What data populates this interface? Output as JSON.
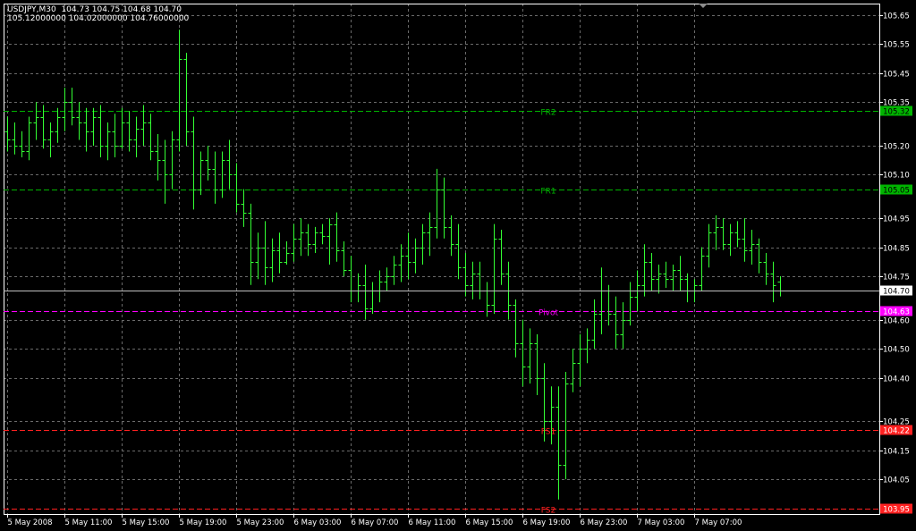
{
  "header": {
    "symbol_timeframe": "USDJPY,M30",
    "ohlc": "104.73 104.75 104.68 104.70",
    "indicator_values": "105.12000000 104.02000000 104.76000000"
  },
  "colors": {
    "background": "#000000",
    "grid": "#6a6a6a",
    "frame": "#ffffff",
    "bars": "#33ff33",
    "resistance": "#00b400",
    "pivot": "#ff00ff",
    "support": "#ff2020",
    "bid_line": "#c0c0c0",
    "axis_text": "#ffffff"
  },
  "chart_data": {
    "type": "ohlc",
    "title": "USDJPY,M30",
    "y_ticks": [
      "105.65",
      "105.55",
      "105.45",
      "105.35",
      "105.20",
      "105.10",
      "104.95",
      "104.85",
      "104.75",
      "104.60",
      "104.50",
      "104.40",
      "104.25",
      "104.15",
      "104.05"
    ],
    "y_tick_values": [
      105.65,
      105.55,
      105.45,
      105.35,
      105.2,
      105.1,
      104.95,
      104.85,
      104.75,
      104.6,
      104.5,
      104.4,
      104.25,
      104.15,
      104.05
    ],
    "ylim": [
      103.93,
      105.69
    ],
    "x_ticks": [
      "5 May 2008",
      "5 May 11:00",
      "5 May 15:00",
      "5 May 19:00",
      "5 May 23:00",
      "6 May 03:00",
      "6 May 07:00",
      "6 May 11:00",
      "6 May 15:00",
      "6 May 19:00",
      "6 May 23:00",
      "7 May 03:00",
      "7 May 07:00"
    ],
    "x_tick_bar_index": [
      0,
      8,
      16,
      24,
      32,
      40,
      48,
      56,
      64,
      72,
      80,
      88,
      96
    ],
    "bars_visible_slots": 121,
    "grid": true,
    "levels": [
      {
        "label": "FR2",
        "value": 105.32,
        "tag": "105.32",
        "kind": "resistance"
      },
      {
        "label": "FR1",
        "value": 105.05,
        "tag": "105.05",
        "kind": "resistance"
      },
      {
        "label": "Pivot",
        "value": 104.63,
        "tag": "104.63",
        "kind": "pivot"
      },
      {
        "label": "FS1",
        "value": 104.22,
        "tag": "104.22",
        "kind": "support"
      },
      {
        "label": "FS2",
        "value": 103.95,
        "tag": "103.95",
        "kind": "support"
      }
    ],
    "current_price": {
      "value": 104.7,
      "tag": "104.70"
    },
    "ohlc": [
      [
        105.25,
        105.3,
        105.18,
        105.22
      ],
      [
        105.22,
        105.28,
        105.17,
        105.2
      ],
      [
        105.2,
        105.25,
        105.16,
        105.18
      ],
      [
        105.18,
        105.3,
        105.15,
        105.28
      ],
      [
        105.28,
        105.35,
        105.22,
        105.3
      ],
      [
        105.3,
        105.34,
        105.19,
        105.22
      ],
      [
        105.22,
        105.28,
        105.16,
        105.25
      ],
      [
        105.25,
        105.33,
        105.21,
        105.3
      ],
      [
        105.3,
        105.4,
        105.25,
        105.35
      ],
      [
        105.35,
        105.4,
        105.27,
        105.3
      ],
      [
        105.3,
        105.35,
        105.22,
        105.28
      ],
      [
        105.28,
        105.33,
        105.18,
        105.25
      ],
      [
        105.25,
        105.33,
        105.2,
        105.3
      ],
      [
        105.3,
        105.34,
        105.16,
        105.2
      ],
      [
        105.2,
        105.28,
        105.15,
        105.25
      ],
      [
        105.25,
        105.31,
        105.16,
        105.2
      ],
      [
        105.2,
        105.33,
        105.19,
        105.28
      ],
      [
        105.28,
        105.32,
        105.18,
        105.22
      ],
      [
        105.22,
        105.3,
        105.16,
        105.26
      ],
      [
        105.26,
        105.34,
        105.2,
        105.28
      ],
      [
        105.28,
        105.31,
        105.15,
        105.18
      ],
      [
        105.18,
        105.24,
        105.08,
        105.15
      ],
      [
        105.15,
        105.22,
        105.0,
        105.1
      ],
      [
        105.1,
        105.25,
        105.05,
        105.22
      ],
      [
        105.22,
        105.6,
        105.18,
        105.5
      ],
      [
        105.5,
        105.52,
        105.2,
        105.25
      ],
      [
        105.25,
        105.3,
        104.98,
        105.05
      ],
      [
        105.05,
        105.18,
        105.03,
        105.15
      ],
      [
        105.15,
        105.2,
        105.08,
        105.12
      ],
      [
        105.12,
        105.18,
        105.0,
        105.05
      ],
      [
        105.05,
        105.18,
        105.02,
        105.15
      ],
      [
        105.15,
        105.22,
        105.05,
        105.1
      ],
      [
        105.1,
        105.14,
        104.97,
        105.0
      ],
      [
        105.0,
        105.05,
        104.92,
        104.97
      ],
      [
        104.97,
        105.0,
        104.72,
        104.8
      ],
      [
        104.8,
        104.9,
        104.74,
        104.85
      ],
      [
        104.85,
        104.94,
        104.72,
        104.78
      ],
      [
        104.78,
        104.88,
        104.73,
        104.84
      ],
      [
        104.84,
        104.9,
        104.76,
        104.8
      ],
      [
        104.8,
        104.87,
        104.79,
        104.83
      ],
      [
        104.83,
        104.93,
        104.8,
        104.88
      ],
      [
        104.88,
        104.95,
        104.82,
        104.9
      ],
      [
        104.9,
        104.93,
        104.82,
        104.86
      ],
      [
        104.86,
        104.92,
        104.83,
        104.9
      ],
      [
        104.9,
        104.93,
        104.86,
        104.89
      ],
      [
        104.89,
        104.95,
        104.79,
        104.93
      ],
      [
        104.93,
        104.97,
        104.8,
        104.84
      ],
      [
        104.84,
        104.87,
        104.75,
        104.77
      ],
      [
        104.77,
        104.82,
        104.66,
        104.7
      ],
      [
        104.7,
        104.76,
        104.66,
        104.72
      ],
      [
        104.72,
        104.79,
        104.6,
        104.64
      ],
      [
        104.64,
        104.73,
        104.62,
        104.7
      ],
      [
        104.7,
        104.77,
        104.66,
        104.73
      ],
      [
        104.73,
        104.78,
        104.7,
        104.75
      ],
      [
        104.75,
        104.82,
        104.72,
        104.79
      ],
      [
        104.79,
        104.86,
        104.73,
        104.82
      ],
      [
        104.82,
        104.9,
        104.74,
        104.8
      ],
      [
        104.8,
        104.88,
        104.76,
        104.85
      ],
      [
        104.85,
        104.93,
        104.79,
        104.9
      ],
      [
        104.9,
        104.97,
        104.82,
        104.92
      ],
      [
        104.92,
        105.12,
        104.88,
        105.05
      ],
      [
        105.05,
        105.09,
        104.88,
        104.92
      ],
      [
        104.92,
        104.96,
        104.82,
        104.86
      ],
      [
        104.86,
        104.93,
        104.74,
        104.78
      ],
      [
        104.78,
        104.83,
        104.68,
        104.72
      ],
      [
        104.72,
        104.8,
        104.67,
        104.76
      ],
      [
        104.76,
        104.8,
        104.67,
        104.7
      ],
      [
        104.7,
        104.73,
        104.61,
        104.65
      ],
      [
        104.65,
        104.93,
        104.62,
        104.88
      ],
      [
        104.88,
        104.91,
        104.72,
        104.76
      ],
      [
        104.76,
        104.8,
        104.6,
        104.65
      ],
      [
        104.65,
        104.67,
        104.47,
        104.52
      ],
      [
        104.52,
        104.6,
        104.37,
        104.44
      ],
      [
        104.44,
        104.57,
        104.38,
        104.52
      ],
      [
        104.52,
        104.55,
        104.34,
        104.4
      ],
      [
        104.4,
        104.45,
        104.18,
        104.25
      ],
      [
        104.25,
        104.37,
        104.17,
        104.3
      ],
      [
        104.3,
        104.37,
        103.98,
        104.1
      ],
      [
        104.1,
        104.42,
        104.05,
        104.38
      ],
      [
        104.38,
        104.5,
        104.35,
        104.45
      ],
      [
        104.45,
        104.55,
        104.37,
        104.5
      ],
      [
        104.5,
        104.57,
        104.45,
        104.53
      ],
      [
        104.53,
        104.67,
        104.5,
        104.62
      ],
      [
        104.62,
        104.78,
        104.55,
        104.7
      ],
      [
        104.7,
        104.72,
        104.58,
        104.62
      ],
      [
        104.62,
        104.68,
        104.5,
        104.55
      ],
      [
        104.55,
        104.66,
        104.5,
        104.6
      ],
      [
        104.6,
        104.73,
        104.58,
        104.68
      ],
      [
        104.68,
        104.77,
        104.63,
        104.72
      ],
      [
        104.72,
        104.86,
        104.68,
        104.8
      ],
      [
        104.8,
        104.83,
        104.7,
        104.74
      ],
      [
        104.74,
        104.79,
        104.69,
        104.76
      ],
      [
        104.76,
        104.8,
        104.71,
        104.74
      ],
      [
        104.74,
        104.79,
        104.7,
        104.77
      ],
      [
        104.77,
        104.82,
        104.7,
        104.74
      ],
      [
        104.74,
        104.76,
        104.66,
        104.7
      ],
      [
        104.7,
        104.74,
        104.66,
        104.72
      ],
      [
        104.72,
        104.85,
        104.7,
        104.82
      ],
      [
        104.82,
        104.93,
        104.78,
        104.9
      ],
      [
        104.9,
        104.96,
        104.84,
        104.92
      ],
      [
        104.92,
        104.95,
        104.84,
        104.86
      ],
      [
        104.86,
        104.93,
        104.82,
        104.9
      ],
      [
        104.9,
        104.94,
        104.85,
        104.88
      ],
      [
        104.88,
        104.95,
        104.8,
        104.84
      ],
      [
        104.84,
        104.91,
        104.79,
        104.86
      ],
      [
        104.86,
        104.88,
        104.76,
        104.8
      ],
      [
        104.8,
        104.83,
        104.72,
        104.76
      ],
      [
        104.76,
        104.8,
        104.66,
        104.72
      ],
      [
        104.73,
        104.75,
        104.68,
        104.7
      ]
    ]
  }
}
